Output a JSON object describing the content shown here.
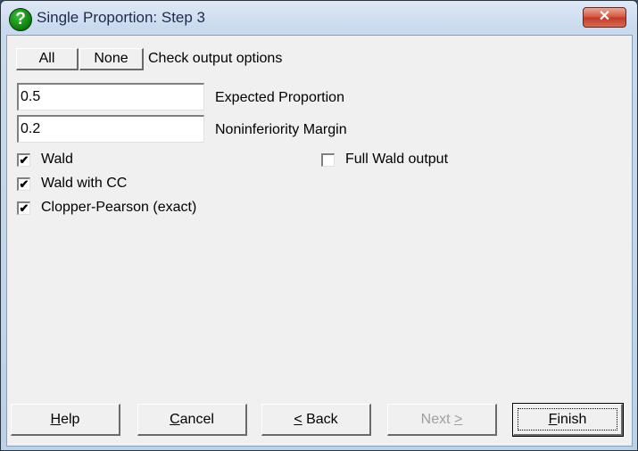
{
  "window": {
    "title": "Single Proportion: Step 3",
    "help_icon_glyph": "?",
    "close_glyph": "✕"
  },
  "toolbar": {
    "all_label": "All",
    "none_label": "None",
    "hint": "Check output options"
  },
  "fields": [
    {
      "label": "Expected Proportion",
      "value": "0.5"
    },
    {
      "label": "Noninferiority Margin",
      "value": "0.2"
    }
  ],
  "checkboxes": [
    {
      "label": "Wald",
      "checked": true
    },
    {
      "label": "Wald with CC",
      "checked": true
    },
    {
      "label": "Clopper-Pearson (exact)",
      "checked": true
    },
    {
      "label": "Full Wald output",
      "checked": false
    }
  ],
  "buttons": {
    "help": {
      "mnemonic": "H",
      "rest": "elp"
    },
    "cancel": {
      "mnemonic": "C",
      "rest": "ancel"
    },
    "back": {
      "mnemonic": "<",
      "rest": " Back"
    },
    "next": {
      "pre": "Next ",
      "mnemonic": ">"
    },
    "finish": {
      "mnemonic": "F",
      "rest": "inish"
    }
  }
}
